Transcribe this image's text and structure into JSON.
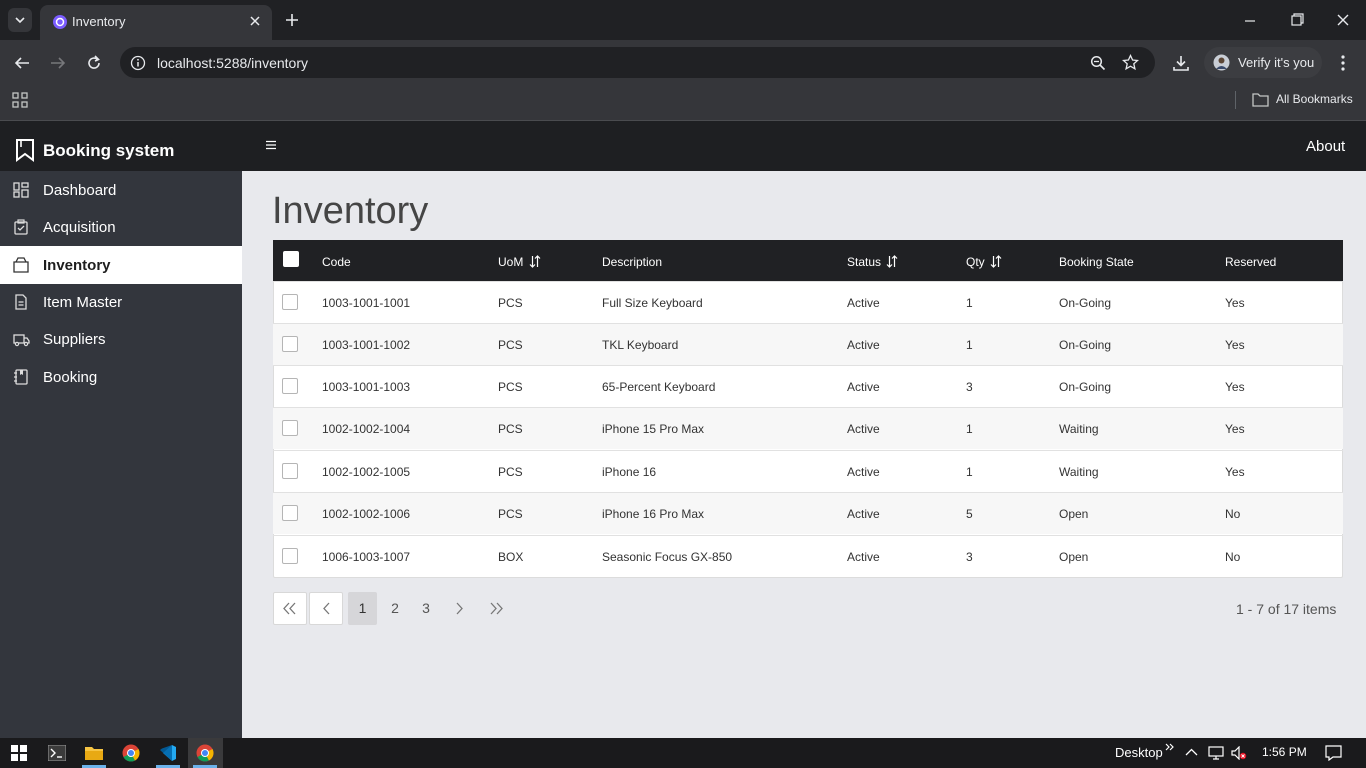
{
  "browser": {
    "tab_title": "Inventory",
    "url": "localhost:5288/inventory",
    "profile_label": "Verify it's you",
    "bookmarks_label": "All Bookmarks"
  },
  "app": {
    "brand": "Booking system",
    "header_link": "About",
    "nav": [
      {
        "label": "Dashboard",
        "icon": "dashboard-icon",
        "active": false
      },
      {
        "label": "Acquisition",
        "icon": "clipboard-check-icon",
        "active": false
      },
      {
        "label": "Inventory",
        "icon": "box-icon",
        "active": true
      },
      {
        "label": "Item Master",
        "icon": "document-icon",
        "active": false
      },
      {
        "label": "Suppliers",
        "icon": "truck-icon",
        "active": false
      },
      {
        "label": "Booking",
        "icon": "book-icon",
        "active": false
      }
    ]
  },
  "page": {
    "title": "Inventory"
  },
  "table": {
    "columns": [
      "Code",
      "UoM",
      "Description",
      "Status",
      "Qty",
      "Booking State",
      "Reserved"
    ],
    "sortable": [
      "UoM",
      "Status",
      "Qty"
    ],
    "rows": [
      [
        "1003-1001-1001",
        "PCS",
        "Full Size Keyboard",
        "Active",
        "1",
        "On-Going",
        "Yes"
      ],
      [
        "1003-1001-1002",
        "PCS",
        "TKL Keyboard",
        "Active",
        "1",
        "On-Going",
        "Yes"
      ],
      [
        "1003-1001-1003",
        "PCS",
        "65-Percent Keyboard",
        "Active",
        "3",
        "On-Going",
        "Yes"
      ],
      [
        "1002-1002-1004",
        "PCS",
        "iPhone 15 Pro Max",
        "Active",
        "1",
        "Waiting",
        "Yes"
      ],
      [
        "1002-1002-1005",
        "PCS",
        "iPhone 16",
        "Active",
        "1",
        "Waiting",
        "Yes"
      ],
      [
        "1002-1002-1006",
        "PCS",
        "iPhone 16 Pro Max",
        "Active",
        "5",
        "Open",
        "No"
      ],
      [
        "1006-1003-1007",
        "BOX",
        "Seasonic Focus GX-850",
        "Active",
        "3",
        "Open",
        "No"
      ]
    ]
  },
  "pager": {
    "pages": [
      "1",
      "2",
      "3"
    ],
    "current": "1",
    "info": "1 - 7 of 17 items"
  },
  "taskbar": {
    "desktop_label": "Desktop",
    "time": "1:56 PM"
  }
}
